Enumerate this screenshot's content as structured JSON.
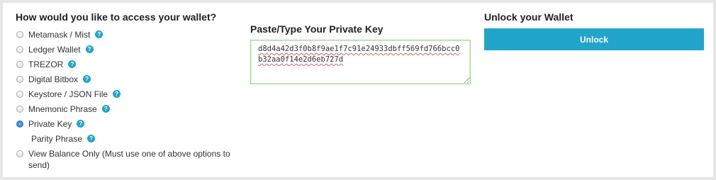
{
  "access": {
    "heading": "How would you like to access your wallet?",
    "options": [
      {
        "label": "Metamask / Mist",
        "checked": false,
        "help_icon": "question-icon"
      },
      {
        "label": "Ledger Wallet",
        "checked": false,
        "help_icon": "question-icon"
      },
      {
        "label": "TREZOR",
        "checked": false,
        "help_icon": "question-icon"
      },
      {
        "label": "Digital Bitbox",
        "checked": false,
        "help_icon": "question-icon"
      },
      {
        "label": "Keystore / JSON File",
        "checked": false,
        "help_icon": "question-icon"
      },
      {
        "label": "Mnemonic Phrase",
        "checked": false,
        "help_icon": "question-icon"
      },
      {
        "label": "Private Key",
        "checked": true,
        "help_icon": "question-icon"
      }
    ],
    "parity_phrase": {
      "label": "Parity Phrase",
      "help_icon": "question-icon"
    },
    "view_balance": {
      "label": "View Balance Only (Must use one of above options to send)",
      "checked": false
    },
    "help_glyph": "?"
  },
  "private_key": {
    "heading": "Paste/Type Your Private Key",
    "value": "d8d4a42d3f0b8f9ae1f7c91e24933dbff569fd766bcc0b32aa0f14e2d6eb727d"
  },
  "unlock": {
    "heading": "Unlock your Wallet",
    "button_label": "Unlock"
  },
  "colors": {
    "accent": "#21a5c9",
    "radio_checked": "#3a8fe0",
    "input_border": "#a6d79a"
  }
}
